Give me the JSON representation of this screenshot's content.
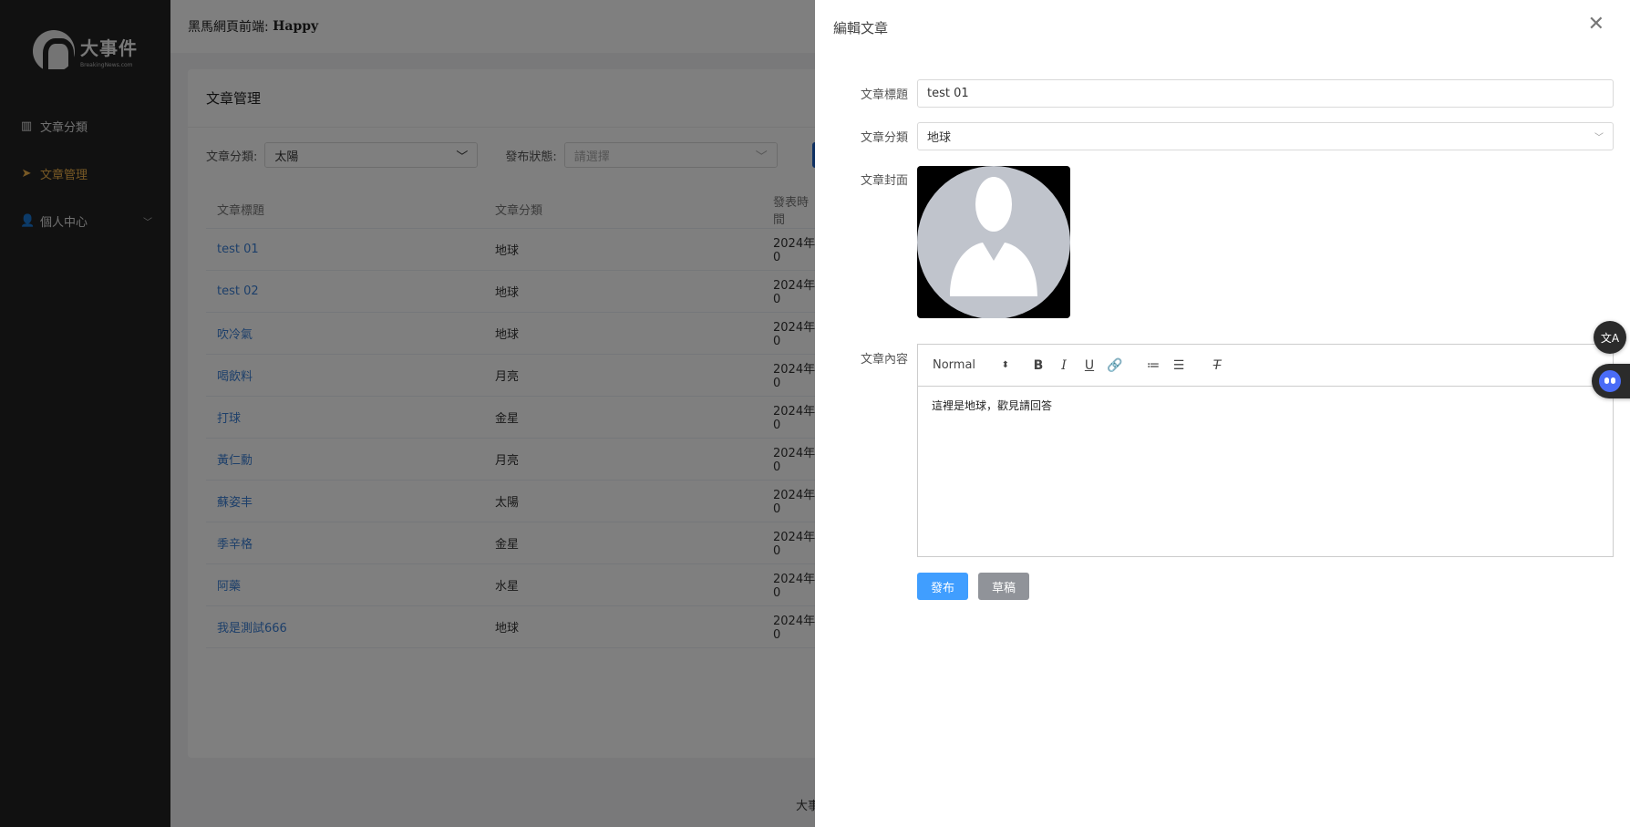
{
  "sidebar": {
    "logo_title": "大事件",
    "logo_sub": "BreakingNews.com",
    "items": [
      {
        "label": "文章分類",
        "icon": "books-icon"
      },
      {
        "label": "文章管理",
        "icon": "send-icon",
        "active": true
      },
      {
        "label": "個人中心",
        "icon": "user-icon",
        "has_children": true
      }
    ]
  },
  "header": {
    "prefix": "黑馬網頁前端: ",
    "user": "Happy"
  },
  "card": {
    "title": "文章管理",
    "filter_category_label": "文章分類:",
    "filter_category_value": "太陽",
    "filter_status_label": "發布狀態:",
    "filter_status_placeholder": "請選擇",
    "columns": [
      "文章標題",
      "文章分類",
      "發表時間"
    ],
    "rows": [
      {
        "title": "test 01",
        "category": "地球",
        "date": "2024年0"
      },
      {
        "title": "test 02",
        "category": "地球",
        "date": "2024年0"
      },
      {
        "title": "吹冷氣",
        "category": "地球",
        "date": "2024年0"
      },
      {
        "title": "喝飲料",
        "category": "月亮",
        "date": "2024年0"
      },
      {
        "title": "打球",
        "category": "金星",
        "date": "2024年0"
      },
      {
        "title": "黃仁勳",
        "category": "月亮",
        "date": "2024年0"
      },
      {
        "title": "蘇姿丰",
        "category": "太陽",
        "date": "2024年0"
      },
      {
        "title": "季辛格",
        "category": "金星",
        "date": "2024年0"
      },
      {
        "title": "阿藥",
        "category": "水星",
        "date": "2024年0"
      },
      {
        "title": "我是測試666",
        "category": "地球",
        "date": "2024年0"
      }
    ],
    "footer": "大事"
  },
  "drawer": {
    "title": "編輯文章",
    "title_label": "文章標題",
    "title_value": "test 01",
    "category_label": "文章分類",
    "category_value": "地球",
    "cover_label": "文章封面",
    "content_label": "文章內容",
    "toolbar": {
      "format": "Normal",
      "bold": "B",
      "italic": "I",
      "underline": "U",
      "clean": "T"
    },
    "content": "這裡是地球，歡見請回答",
    "publish_label": "發布",
    "draft_label": "草稿"
  },
  "floating": {
    "translate_icon": "translate-icon",
    "assistant_icon": "bot-icon"
  },
  "colors": {
    "sidebar_bg": "#232323",
    "active": "#f0b24a",
    "primary": "#409eff",
    "link": "#3a7fd5"
  }
}
